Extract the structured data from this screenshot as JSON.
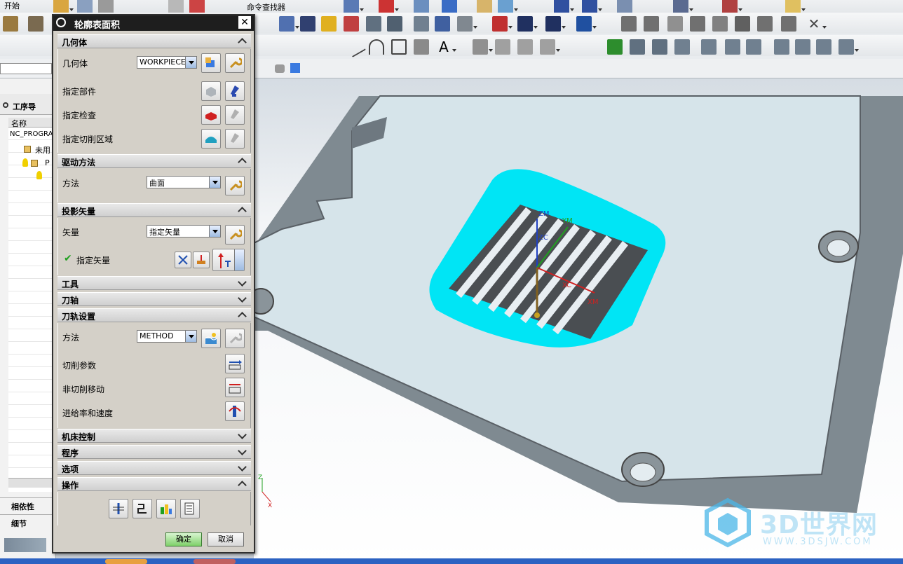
{
  "toolbar": {
    "menu_label": "开始",
    "command_finder": "命令查找器"
  },
  "navigator": {
    "title": "工序导",
    "column_name": "名称",
    "root": "NC_PROGRAM",
    "unused_item": "未用",
    "program_item": "P",
    "dependency_label": "相依性",
    "details_label": "细节"
  },
  "dialog": {
    "title": "轮廓表面积",
    "geometry": {
      "section_label": "几何体",
      "geometry_label": "几何体",
      "geometry_value": "WORKPIECE",
      "part_label": "指定部件",
      "check_label": "指定检查",
      "cut_area_label": "指定切削区域"
    },
    "drive": {
      "section_label": "驱动方法",
      "method_label": "方法",
      "method_value": "曲面"
    },
    "projection": {
      "section_label": "投影矢量",
      "vector_label": "矢量",
      "vector_value": "指定矢量",
      "specify_vector_label": "指定矢量"
    },
    "tool_section": "工具",
    "axis_section": "刀轴",
    "path": {
      "section_label": "刀轨设置",
      "method_label": "方法",
      "method_value": "METHOD",
      "cut_params_label": "切削参数",
      "non_cut_label": "非切削移动",
      "feeds_label": "进给率和速度"
    },
    "machine_section": "机床控制",
    "program_section": "程序",
    "options_section": "选项",
    "actions_section": "操作",
    "ok_label": "确定",
    "cancel_label": "取消"
  },
  "viewport": {
    "labels": {
      "zm": "ZM",
      "ym": "YM",
      "xm": "XM",
      "zc": "ZC",
      "xc": "XC",
      "triad_x": "X",
      "triad_z": "Z"
    },
    "colors": {
      "part_face": "#d6e4ea",
      "part_side": "#8a959c",
      "cut_area": "#00e5f5"
    }
  },
  "watermark": {
    "brand": "3D世界网",
    "url": "WWW.3DSJW.COM"
  }
}
